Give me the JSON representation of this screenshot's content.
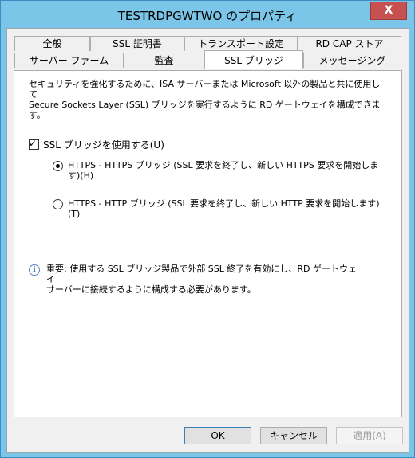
{
  "window": {
    "title": "TESTRDPGWTWO のプロパティ",
    "close_glyph": "X"
  },
  "tabs_top": [
    "全般",
    "SSL 証明書",
    "トランスポート設定",
    "RD CAP ストア"
  ],
  "tabs_bottom": [
    "サーバー ファーム",
    "監査",
    "SSL ブリッジ",
    "メッセージング"
  ],
  "active_tab": "SSL ブリッジ",
  "panel": {
    "description_line1": "セキュリティを強化するために、ISA サーバーまたは Microsoft 以外の製品と共に使用して",
    "description_line2": "Secure Sockets Layer (SSL) ブリッジを実行するように RD ゲートウェイを構成できます。",
    "use_ssl_bridge_label": "SSL ブリッジを使用する(U)",
    "use_ssl_bridge_checked": true,
    "radio_https_label": "HTTPS - HTTPS ブリッジ (SSL 要求を終了し、新しい HTTPS 要求を開始しま す)(H)",
    "radio_https_selected": true,
    "radio_http_label": "HTTPS - HTTP ブリッジ (SSL 要求を終了し、新しい HTTP 要求を開始します) (T)",
    "radio_http_selected": false,
    "info_text_line1": "重要: 使用する SSL ブリッジ製品で外部 SSL 終了を有効にし、RD ゲートウェイ",
    "info_text_line2": "サーバーに接続するように構成する必要があります。"
  },
  "buttons": {
    "ok": "OK",
    "cancel": "キャンセル",
    "apply": "適用(A)"
  },
  "colors": {
    "titlebar": "#7bc6e8",
    "close_button": "#c75050",
    "face": "#f0f0f0"
  }
}
